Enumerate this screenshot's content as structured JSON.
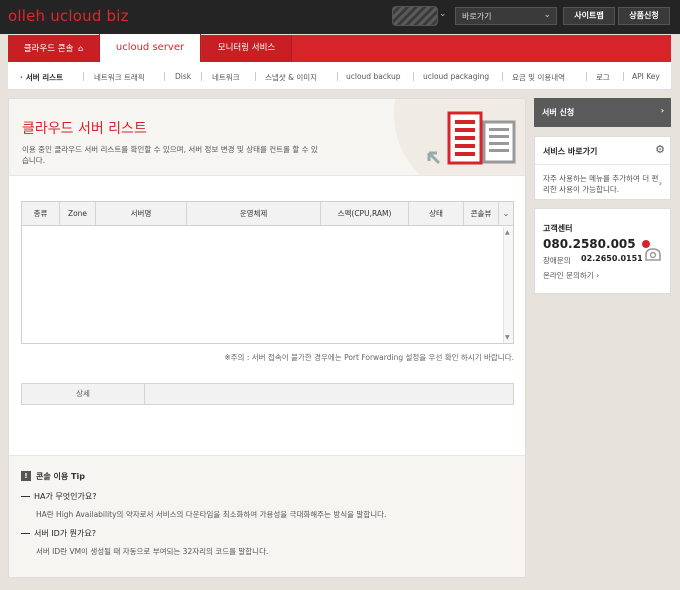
{
  "header": {
    "logo": "olleh ucloud biz",
    "shortcut_select": "바로가기",
    "sitemap": "사이트맵",
    "product_apply": "상품신청"
  },
  "tabs": [
    {
      "label": "클라우드 콘솔"
    },
    {
      "label": "ucloud server"
    },
    {
      "label": "모니터링 서비스"
    }
  ],
  "subnav": [
    {
      "label": "서버 리스트"
    },
    {
      "label": "네트워크 트래픽"
    },
    {
      "label": "Disk"
    },
    {
      "label": "네트워크"
    },
    {
      "label": "스냅샷 & 이미지"
    },
    {
      "label": "ucloud backup"
    },
    {
      "label": "ucloud packaging"
    },
    {
      "label": "요금 및 이용내역"
    },
    {
      "label": "로그"
    },
    {
      "label": "API Key"
    }
  ],
  "page": {
    "title": "클라우드 서버 리스트",
    "desc": "이용 중인 클라우드 서버 리스트를 확인할 수 있으며, 서버 정보 변경 및 상태를 컨트롤 할 수 있습니다."
  },
  "table": {
    "columns": [
      "종류",
      "Zone",
      "서버명",
      "운영체제",
      "스펙(CPU,RAM)",
      "상태",
      "콘솔뷰"
    ]
  },
  "notice": "※주의 : 서버 접속이 불가한 경우에는 Port Forwarding 설정을 우선 확인 하시기 바랍니다.",
  "detail": {
    "label": "상세"
  },
  "tips": {
    "title": "콘솔 이용 Tip",
    "items": [
      {
        "q": "HA가 무엇인가요?",
        "a": "HA란 High Availability의 약자로서 서비스의 다운타임을 최소화하여 가용성을 극대화해주는 방식을 말합니다."
      },
      {
        "q": "서버 ID가 뭔가요?",
        "a": "서버 ID란 VM이 생성될 때 자동으로 부여되는 32자리의 코드를 말합니다."
      }
    ]
  },
  "sidebar": {
    "apply": "서버 신청",
    "shortcut": {
      "title": "서비스 바로가기",
      "desc": "자주 사용하는 메뉴를 추가하여 더 편리한 사용이 가능합니다."
    },
    "cs": {
      "title": "고객센터",
      "phone": "080.2580.005",
      "fault_label": "장애문의",
      "fault_num": "02.2650.0151",
      "online": "온라인 문의하기"
    }
  },
  "colors": {
    "brand_red": "#d7242a",
    "topbar": "#242424"
  },
  "icons": [
    "home-icon",
    "gear-icon",
    "phone-icon",
    "server-list-icon",
    "arrow-right-icon",
    "chevron-down-icon"
  ]
}
